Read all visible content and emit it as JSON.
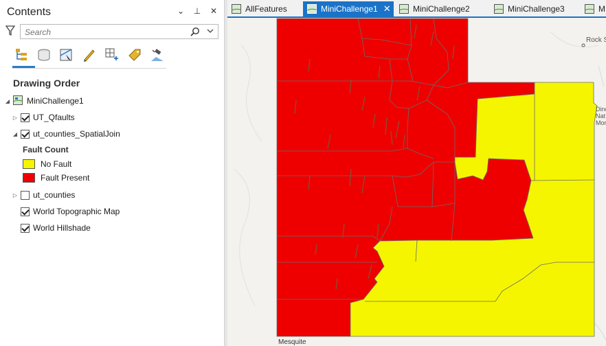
{
  "contents": {
    "title": "Contents",
    "controls": {
      "dropdown": "⌄",
      "pin": "⊥",
      "close": "✕"
    },
    "search_placeholder": "Search",
    "drawing_order_label": "Drawing Order",
    "map_name": "MiniChallenge1",
    "layers": [
      {
        "name": "UT_Qfaults",
        "checked": true,
        "expanded": false
      },
      {
        "name": "ut_counties_SpatialJoin",
        "checked": true,
        "expanded": true
      },
      {
        "name": "ut_counties",
        "checked": false,
        "expanded": false
      },
      {
        "name": "World Topographic Map",
        "checked": true
      },
      {
        "name": "World Hillshade",
        "checked": true
      }
    ],
    "legend": {
      "heading": "Fault Count",
      "items": [
        {
          "label": "No Fault",
          "color": "#f5f500"
        },
        {
          "label": "Fault Present",
          "color": "#ee0000"
        }
      ]
    },
    "toolbar_icons": [
      "drawing-order-icon",
      "data-source-icon",
      "selection-icon",
      "editing-icon",
      "snapping-icon",
      "labeling-icon",
      "perspective-imagery-icon"
    ]
  },
  "tabs": [
    {
      "label": "AllFeatures",
      "active": false
    },
    {
      "label": "MiniChallenge1",
      "active": true
    },
    {
      "label": "MiniChallenge2",
      "active": false
    },
    {
      "label": "MiniChallenge3",
      "active": false
    },
    {
      "label": "M",
      "active": false
    }
  ],
  "map": {
    "labels": {
      "rock_springs": "Rock S",
      "dinosaur": "Dino",
      "nat": "Nat",
      "mon": "Mon",
      "mesquite": "Mesquite"
    },
    "colors": {
      "no_fault": "#f5f500",
      "fault_present": "#ee0000",
      "border": "#6b6b6b",
      "fault_line": "#7a5a3a",
      "tab_accent": "#1a73c8"
    }
  }
}
